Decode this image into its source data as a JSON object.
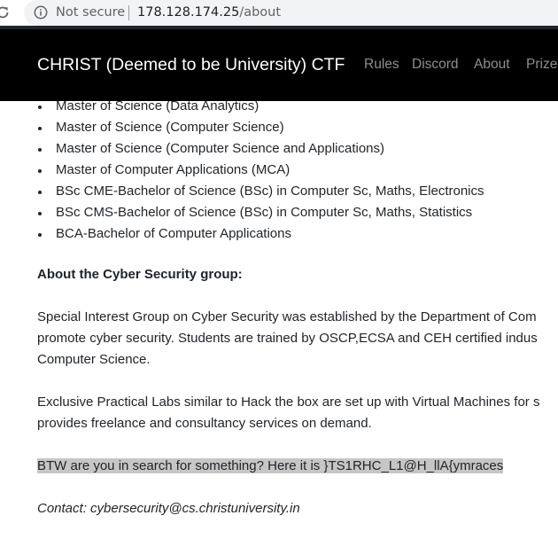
{
  "browser": {
    "security_label": "Not secure",
    "url_host": "178.128.174.25",
    "url_path": "/about"
  },
  "navbar": {
    "brand": "CHRIST (Deemed to be University) CTF",
    "links": [
      "Rules",
      "Discord",
      "About",
      "Prizes"
    ]
  },
  "programs": [
    "Master of Science (Data Analytics)",
    "Master of Science (Computer Science)",
    "Master of Science (Computer Science and Applications)",
    "Master of Computer Applications (MCA)",
    "BSc CME-Bachelor of Science (BSc) in Computer Sc, Maths, Electronics",
    "BSc CMS-Bachelor of Science (BSc) in Computer Sc, Maths, Statistics",
    "BCA-Bachelor of Computer Applications"
  ],
  "about_heading": "About the Cyber Security group:",
  "paragraph1": [
    "Special Interest Group on Cyber Security was established by the Department of Com",
    "promote cyber security. Students are trained by OSCP,ECSA and CEH certified indus",
    "Computer Science."
  ],
  "paragraph2": [
    "Exclusive Practical Labs similar to Hack the box are set up with Virtual Machines for s",
    "provides freelance and consultancy services on demand."
  ],
  "btw_text": "BTW are you in search for something? Here it is }TS1RHC_L1@H_llA{ymraces",
  "contact_text": "Contact: cybersecurity@cs.christuniversity.in",
  "colors": {
    "navbar_bg": "#000000",
    "highlight": "#c6c6c6",
    "text": "#212529"
  }
}
